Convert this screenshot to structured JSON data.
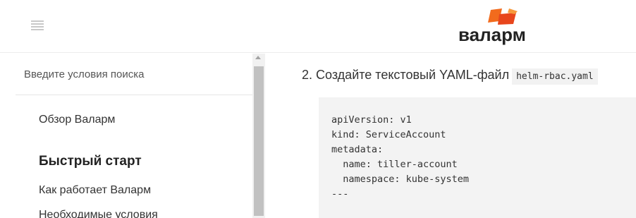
{
  "header": {
    "menu_icon": "hamburger-menu-icon",
    "logo_text": "валарм",
    "logo_colors": {
      "primary": "#f26b1d",
      "secondary": "#e8461c"
    }
  },
  "sidebar": {
    "search_placeholder": "Введите условия поиска",
    "items": [
      {
        "label": "Обзор Валарм",
        "type": "link"
      },
      {
        "label": "Быстрый старт",
        "type": "heading"
      },
      {
        "label": "Как работает Валарм",
        "type": "link"
      },
      {
        "label": "Необходимые условия",
        "type": "link"
      }
    ]
  },
  "main": {
    "step_text": "2. Создайте текстовый YAML-файл",
    "step_filename": "helm-rbac.yaml",
    "code_lines": [
      "apiVersion: v1",
      "kind: ServiceAccount",
      "metadata:",
      "  name: tiller-account",
      "  namespace: kube-system",
      "---"
    ]
  }
}
